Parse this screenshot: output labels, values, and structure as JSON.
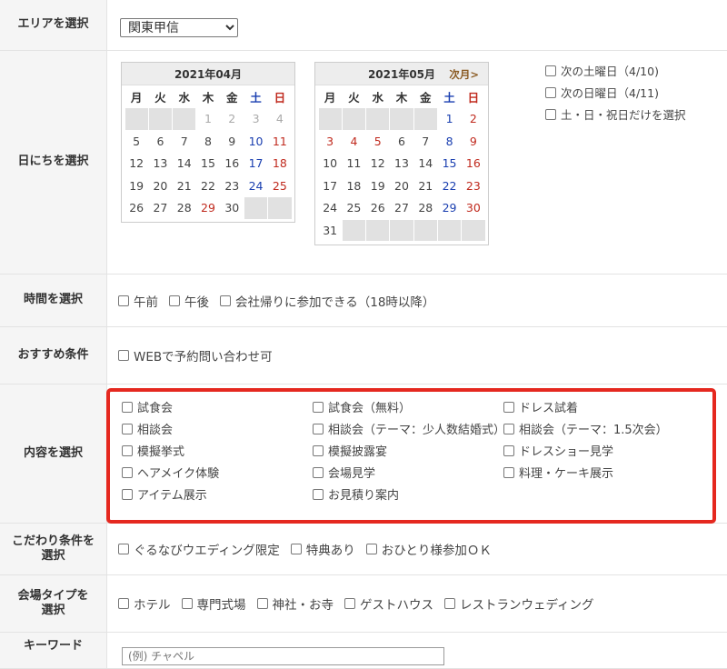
{
  "area": {
    "label": "エリアを選択",
    "selected": "関東甲信"
  },
  "dates": {
    "label": "日にちを選択",
    "weekdays": [
      "月",
      "火",
      "水",
      "木",
      "金",
      "土",
      "日"
    ],
    "april": {
      "title": "2021年04月",
      "rows": [
        [
          "",
          "",
          "",
          "1",
          "2",
          "3",
          "4"
        ],
        [
          "5",
          "6",
          "7",
          "8",
          "9",
          "10",
          "11"
        ],
        [
          "12",
          "13",
          "14",
          "15",
          "16",
          "17",
          "18"
        ],
        [
          "19",
          "20",
          "21",
          "22",
          "23",
          "24",
          "25"
        ],
        [
          "26",
          "27",
          "28",
          "29",
          "30",
          "",
          ""
        ]
      ]
    },
    "may": {
      "title": "2021年05月",
      "next_label": "次月>",
      "rows": [
        [
          "",
          "",
          "",
          "",
          "",
          "1",
          "2"
        ],
        [
          "3",
          "4",
          "5",
          "6",
          "7",
          "8",
          "9"
        ],
        [
          "10",
          "11",
          "12",
          "13",
          "14",
          "15",
          "16"
        ],
        [
          "17",
          "18",
          "19",
          "20",
          "21",
          "22",
          "23"
        ],
        [
          "24",
          "25",
          "26",
          "27",
          "28",
          "29",
          "30"
        ],
        [
          "31",
          "",
          "",
          "",
          "",
          "",
          ""
        ]
      ]
    },
    "quick": [
      "次の土曜日（4/10)",
      "次の日曜日（4/11)",
      "土・日・祝日だけを選択"
    ]
  },
  "time": {
    "label": "時間を選択",
    "options": [
      "午前",
      "午後",
      "会社帰りに参加できる（18時以降）"
    ]
  },
  "recommend": {
    "label": "おすすめ条件",
    "options": [
      "WEBで予約問い合わせ可"
    ]
  },
  "content": {
    "label": "内容を選択",
    "options": [
      "試食会",
      "試食会（無料）",
      "ドレス試着",
      "相談会",
      "相談会（テーマ：少人数結婚式）",
      "相談会（テーマ：1.5次会）",
      "模擬挙式",
      "模擬披露宴",
      "ドレスショー見学",
      "ヘアメイク体験",
      "会場見学",
      "料理・ケーキ展示",
      "アイテム展示",
      "お見積り案内",
      ""
    ]
  },
  "kodawari": {
    "label_line1": "こだわり条件を",
    "label_line2": "選択",
    "options": [
      "ぐるなびウエディング限定",
      "特典あり",
      "おひとり様参加ＯＫ"
    ]
  },
  "venue": {
    "label_line1": "会場タイプを",
    "label_line2": "選択",
    "options": [
      "ホテル",
      "専門式場",
      "神社・お寺",
      "ゲストハウス",
      "レストランウェディング"
    ]
  },
  "keyword": {
    "label": "キーワード",
    "placeholder": "(例) チャペル"
  },
  "colors": {
    "highlight": "#e5281f",
    "saturday": "#1a3fb0",
    "sunday": "#c02a1e",
    "label_bg": "#f5f5f5"
  }
}
